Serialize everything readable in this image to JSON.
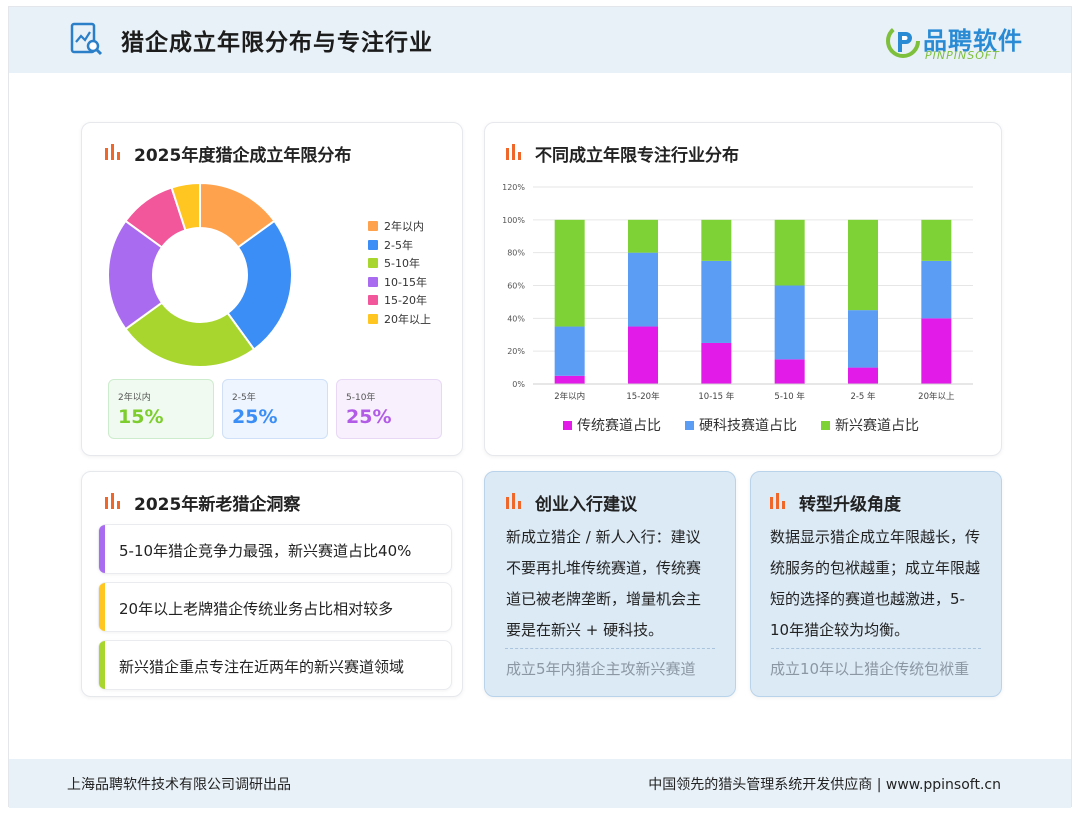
{
  "header": {
    "title": "猎企成立年限分布与专注行业",
    "logo_cn": "品聘软件",
    "logo_en": "PINPINSOFT",
    "logo_color": "#2a8bd5",
    "logo_accent": "#7ebf3c"
  },
  "donut_card": {
    "title": "2025年度猎企成立年限分布",
    "chart_data": {
      "type": "pie",
      "categories": [
        "2年以内",
        "2-5年",
        "5-10年",
        "10-15年",
        "15-20年",
        "20年以上"
      ],
      "values": [
        15,
        25,
        25,
        20,
        10,
        5
      ],
      "colors": [
        "#ffa24d",
        "#3a8ef6",
        "#a8d62e",
        "#a96cf0",
        "#f2569b",
        "#ffc521"
      ],
      "legend_position": "right"
    },
    "stats": [
      {
        "label": "2年以内",
        "value": "15%",
        "color": "#7ccd2d",
        "bg": "#f0faf0",
        "border": "#cdeccd"
      },
      {
        "label": "2-5年",
        "value": "25%",
        "color": "#3a8ef6",
        "bg": "#eef5fe",
        "border": "#cfe0f8"
      },
      {
        "label": "5-10年",
        "value": "25%",
        "color": "#b25be6",
        "bg": "#f8f1fd",
        "border": "#e8d8f6"
      }
    ]
  },
  "bar_card": {
    "title": "不同成立年限专注行业分布",
    "chart_data": {
      "type": "bar",
      "stacked": true,
      "categories": [
        "2年以内",
        "15-20年",
        "10-15 年",
        "5-10 年",
        "2-5 年",
        "20年以上"
      ],
      "series": [
        {
          "name": "传统赛道占比",
          "color": "#e21be8",
          "values": [
            5,
            35,
            25,
            15,
            10,
            40
          ]
        },
        {
          "name": "硬科技赛道占比",
          "color": "#5b9cf5",
          "values": [
            30,
            45,
            50,
            45,
            35,
            35
          ]
        },
        {
          "name": "新兴赛道占比",
          "color": "#7fd235",
          "values": [
            65,
            20,
            25,
            40,
            55,
            25
          ]
        }
      ],
      "ylim": [
        0,
        120
      ],
      "yticks": [
        "0%",
        "20%",
        "40%",
        "60%",
        "80%",
        "100%",
        "120%"
      ],
      "grid": true,
      "legend_position": "bottom"
    }
  },
  "insights_card": {
    "title": "2025年新老猎企洞察",
    "items": [
      {
        "text": "5-10年猎企竞争力最强，新兴赛道占比40%",
        "color": "#a96cf0"
      },
      {
        "text": "20年以上老牌猎企传统业务占比相对较多",
        "color": "#ffc521"
      },
      {
        "text": "新兴猎企重点专注在近两年的新兴赛道领域",
        "color": "#a8d62e"
      }
    ]
  },
  "advice_card": {
    "title": "创业入行建议",
    "body": "新成立猎企 / 新人入行：建议不要再扎堆传统赛道，传统赛道已被老牌垄断，增量机会主要是在新兴 + 硬科技。",
    "footnote": "成立5年内猎企主攻新兴赛道"
  },
  "upgrade_card": {
    "title": "转型升级角度",
    "body": "数据显示猎企成立年限越长，传统服务的包袱越重；成立年限越短的选择的赛道也越激进，5-10年猎企较为均衡。",
    "footnote": "成立10年以上猎企传统包袱重"
  },
  "footer": {
    "left": "上海品聘软件技术有限公司调研出品",
    "right": "中国领先的猎头管理系统开发供应商 |  www.ppinsoft.cn"
  },
  "accent_icon_color": "#f0672a"
}
